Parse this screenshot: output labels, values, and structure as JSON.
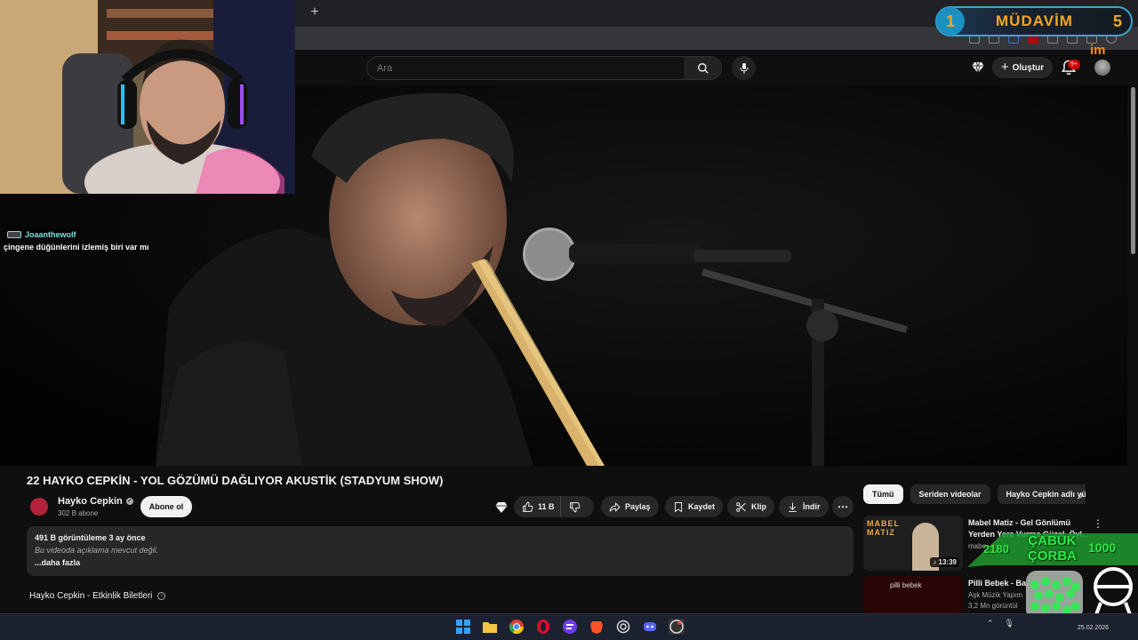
{
  "browser": {
    "new_tab_icon": "plus-icon",
    "extension_icons": [
      "cast-icon",
      "star-icon",
      "extension-icon",
      "record-icon",
      "pen-icon",
      "puzzle-icon",
      "download-icon",
      "profile-icon"
    ]
  },
  "header": {
    "search_placeholder": "Ara",
    "create_label": "Oluştur",
    "notification_count": "9+"
  },
  "overlay": {
    "chat_user": "Joaanthewolf",
    "chat_message": "çingene düğünlerini izlemiş biri var mı",
    "mudavim_rank": "1",
    "mudavim_label": "MÜDAVİM",
    "mudavim_count": "5",
    "logo_text": "im",
    "corba_text_line1": "ÇABUK",
    "corba_text_line2": "ÇORBA",
    "corba_left_value": "2180",
    "corba_right_value": "1000"
  },
  "video": {
    "title": "22 HAYKO CEPKİN - YOL GÖZÜMÜ DAĞLIYOR AKUSTİK (STADYUM SHOW)",
    "channel_name": "Hayko Cepkin",
    "subscribers": "302 B abone",
    "subscribe_label": "Abone ol",
    "likes": "11 B",
    "share_label": "Paylaş",
    "save_label": "Kaydet",
    "clip_label": "Klip",
    "download_label": "İndir",
    "more_label": "⋯",
    "views_date": "491 B görüntüleme  3 ay önce",
    "description": "Bu videoda açıklama mevcut değil.",
    "show_more": "...daha fazla",
    "tickets": "Hayko Cepkin - Etkinlik Biletleri"
  },
  "sidebar": {
    "chips": [
      {
        "label": "Tümü"
      },
      {
        "label": "Seriden videolar"
      },
      {
        "label": "Hayko Cepkin adlı yü"
      }
    ],
    "recommendations": [
      {
        "title": "Mabel Matiz - Gel Gönlümü Yerden Yere Vurma Güzel, Öyl...",
        "channel": "mabe",
        "views": "",
        "duration": "13:39",
        "thumb_text": "MABEL MATIZ"
      },
      {
        "title": "Pilli Bebek - Ba",
        "channel": "Aşk Müzik Yapım",
        "views": "3,2 Mn görüntül",
        "duration": "",
        "thumb_text": "pilli bebek"
      }
    ]
  },
  "taskbar": {
    "apps": [
      "windows-start-icon",
      "file-explorer-icon",
      "chrome-icon",
      "opera-icon",
      "app-icon",
      "brave-icon",
      "chatgpt-icon",
      "discord-icon",
      "obs-icon"
    ],
    "date": "25.02.2026"
  },
  "colors": {
    "youtube_bg": "#0f0f0f",
    "button_bg": "#272727",
    "overlay_orange": "#f5a623",
    "overlay_green": "#2ee84a",
    "accent_red": "#cc0000"
  }
}
